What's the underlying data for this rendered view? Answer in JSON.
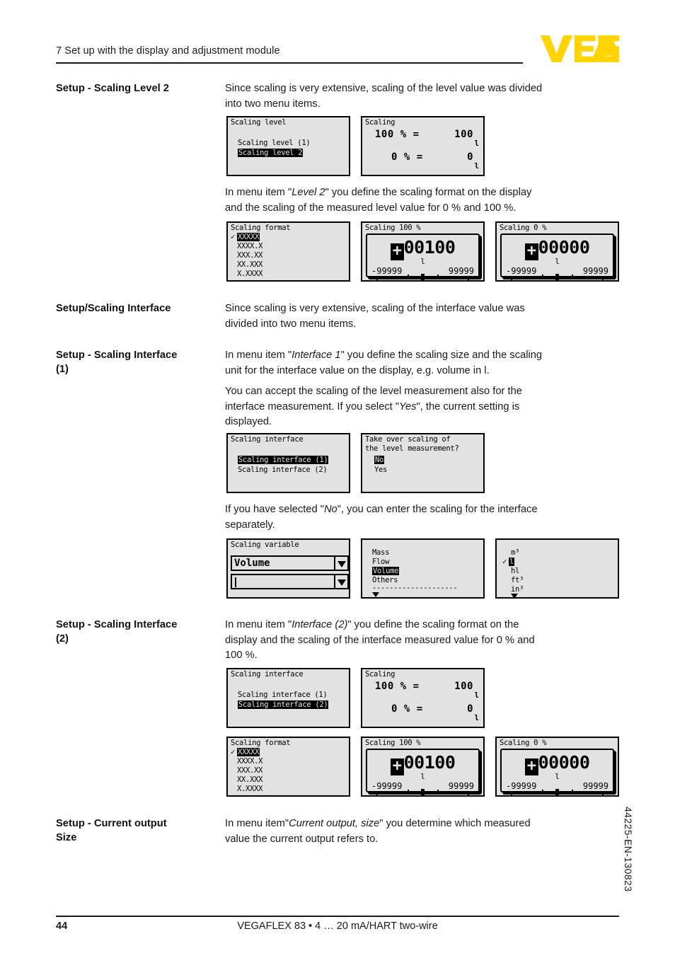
{
  "header": {
    "title": "7 Set up with the display and adjustment module",
    "logo_text": "VEGA",
    "logo_color": "#FFD400"
  },
  "sections": [
    {
      "label": "Setup - Scaling Level 2",
      "paragraphs": [
        "Since scaling is very extensive, scaling of the level value was divided into two menu items.",
        "In menu item \"Level 2\" you define the scaling format on the display and the scaling of the measured level value for 0 % and 100 %."
      ]
    },
    {
      "label": "Setup/Scaling Interface",
      "paragraphs": [
        "Since scaling is very extensive, scaling of the interface value was divided into two menu items."
      ]
    },
    {
      "label": "Setup - Scaling Interface (1)",
      "paragraphs": [
        "In menu item \"Interface 1\" you define the scaling size and the scaling unit for the interface value on the display, e.g. volume in l.",
        "You can accept the scaling of the level measurement also for the interface measurement. If you select \"Yes\", the current setting is displayed.",
        "If you have selected \"No\", you can enter the scaling for the interface separately."
      ]
    },
    {
      "label": "Setup - Scaling Interface (2)",
      "paragraphs": [
        "In menu item \"Interface (2)\" you define the scaling format on the display and the scaling of the interface measured value for 0 % and 100 %."
      ]
    },
    {
      "label": "Setup - Current output Size",
      "paragraphs": [
        "In menu item\"Current output, size\" you determine which measured value the current output refers to."
      ]
    }
  ],
  "body": {
    "label_1": "Setup - Scaling Level 2",
    "label_2": "Setup/Scaling Interface",
    "label_3a": "Setup - Scaling Interface",
    "label_3b": "(1)",
    "label_4a": "Setup - Scaling Interface",
    "label_4b": "(2)",
    "label_5a": "Setup - Current output",
    "label_5b": "Size",
    "p1_line1": "Since scaling is very extensive, scaling of the level value was divided",
    "p1_line2": "into two menu items.",
    "p2_pre": "In menu item \"",
    "p2_it": "Level 2",
    "p2_post": "\" you define the scaling format on the display",
    "p2_line2": "and the scaling of the measured level value for 0 % and 100 %.",
    "p3_line1": "Since scaling is very extensive, scaling of the interface value was",
    "p3_line2": "divided into two menu items.",
    "p4_pre": "In menu item \"",
    "p4_it": "Interface 1",
    "p4_post": "\" you define the scaling size and the scaling",
    "p4_line2": "unit for the interface value on the display, e.g. volume in l.",
    "p5_line1": "You can accept the scaling of the level measurement also for the",
    "p5_line2_pre": "interface measurement. If you select \"",
    "p5_line2_it": "Yes",
    "p5_line2_post": "\", the current setting is",
    "p5_line3": "displayed.",
    "p6_pre": "If you have selected \"",
    "p6_it": "No",
    "p6_post": "\", you can enter the scaling for the interface",
    "p6_line2": "separately.",
    "p7_pre": "In menu item \"",
    "p7_it": "Interface (2)",
    "p7_post": "\" you define the scaling format on the",
    "p7_line2": "display and the scaling of the interface measured value for 0 % and",
    "p7_line3": "100 %.",
    "p8_pre": "In menu item\"",
    "p8_it": "Current output, size",
    "p8_post": "\" you determine which measured",
    "p8_line2": "value the current output refers to."
  },
  "lcd": {
    "scaling_level_menu": {
      "title": "Scaling level",
      "item1": "Scaling level (1)",
      "item2_selected": "Scaling level 2"
    },
    "scaling_values": {
      "title": "Scaling",
      "row1_left": "100 % =",
      "row1_right": "100",
      "row1_unit": "l",
      "row2_left": "0 % =",
      "row2_right": "0",
      "row2_unit": "l"
    },
    "scaling_format": {
      "title": "Scaling format",
      "options": [
        "XXXXX",
        "XXXX.X",
        "XXX.XX",
        "XX.XXX",
        "X.XXXX"
      ],
      "selected_index": 0
    },
    "scaling_100": {
      "title": "Scaling 100 %",
      "sign": "+",
      "value": "00100",
      "unit": "l",
      "min": "-99999",
      "max": "99999"
    },
    "scaling_0": {
      "title": "Scaling 0 %",
      "sign": "+",
      "value": "00000",
      "unit": "l",
      "min": "-99999",
      "max": "99999"
    },
    "scaling_interface_menu": {
      "title": "Scaling interface",
      "item1_selected": "Scaling interface (1)",
      "item2": "Scaling interface (2)"
    },
    "takeover_dialog": {
      "line1": "Take over scaling of",
      "line2": "the level measurement?",
      "option_no_selected": "No",
      "option_yes": "Yes"
    },
    "scaling_variable": {
      "title": "Scaling variable",
      "field1_value": "Volume",
      "field2_value": ""
    },
    "variable_list": {
      "options": [
        "Mass",
        "Flow",
        "Volume",
        "Others"
      ],
      "selected_index": 2,
      "separator": "--------------------"
    },
    "unit_list": {
      "options": [
        "m³",
        "l",
        "hl",
        "ft³",
        "in³"
      ],
      "selected_index": 1
    },
    "scaling_interface_menu2": {
      "title": "Scaling interface",
      "item1": "Scaling interface (1)",
      "item2_selected": "Scaling interface (2)"
    }
  },
  "footer": {
    "page_number": "44",
    "doc_title": "VEGAFLEX 83 • 4 … 20 mA/HART two-wire",
    "side_code": "44225-EN-130823"
  }
}
